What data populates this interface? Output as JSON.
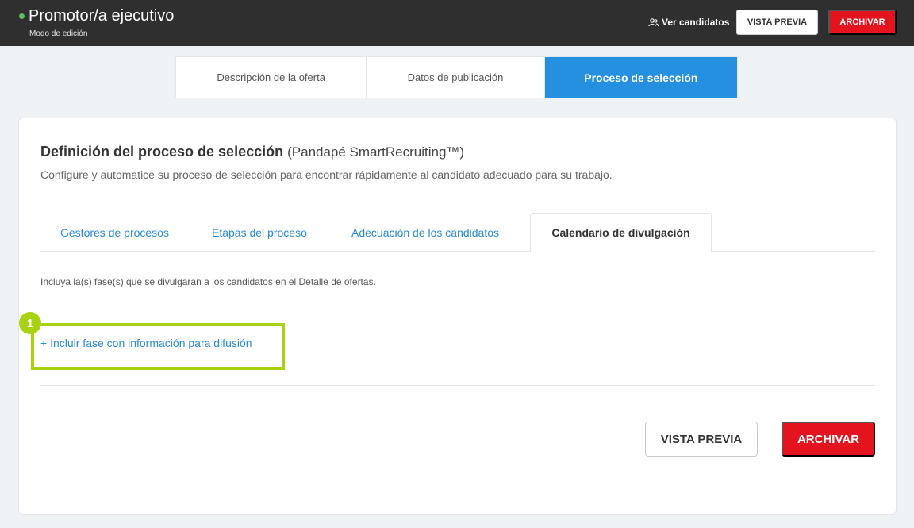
{
  "header": {
    "title": "Promotor/a ejecutivo",
    "mode": "Modo de edición",
    "ver_candidatos": "Ver candidatos",
    "preview_label": "VISTA PREVIA",
    "archive_label": "ARCHIVAR",
    "status_color": "#5cc15c"
  },
  "main_tabs": [
    {
      "label": "Descripción de la oferta",
      "active": false
    },
    {
      "label": "Datos de publicación",
      "active": false
    },
    {
      "label": "Proceso de selección",
      "active": true
    }
  ],
  "section": {
    "title": "Definición del proceso de selección",
    "subtitle": "(Pandapé SmartRecruiting™)",
    "description": "Configure y automatice su proceso de selección para encontrar rápidamente al candidato adecuado para su trabajo."
  },
  "sub_tabs": [
    {
      "label": "Gestores de procesos",
      "active": false
    },
    {
      "label": "Etapas del proceso",
      "active": false
    },
    {
      "label": "Adecuación de los candidatos",
      "active": false
    },
    {
      "label": "Calendario de divulgación",
      "active": true
    }
  ],
  "calendar": {
    "info": "Incluya la(s) fase(s) que se divulgarán a los candidatos en el Detalle de ofertas.",
    "add_link": "+ Incluir fase con información para difusión",
    "badge": "1"
  },
  "footer": {
    "preview_label": "VISTA PREVIA",
    "archive_label": "ARCHIVAR"
  },
  "colors": {
    "accent": "#2590e0",
    "danger": "#e3141e",
    "highlight": "#a8d212"
  }
}
